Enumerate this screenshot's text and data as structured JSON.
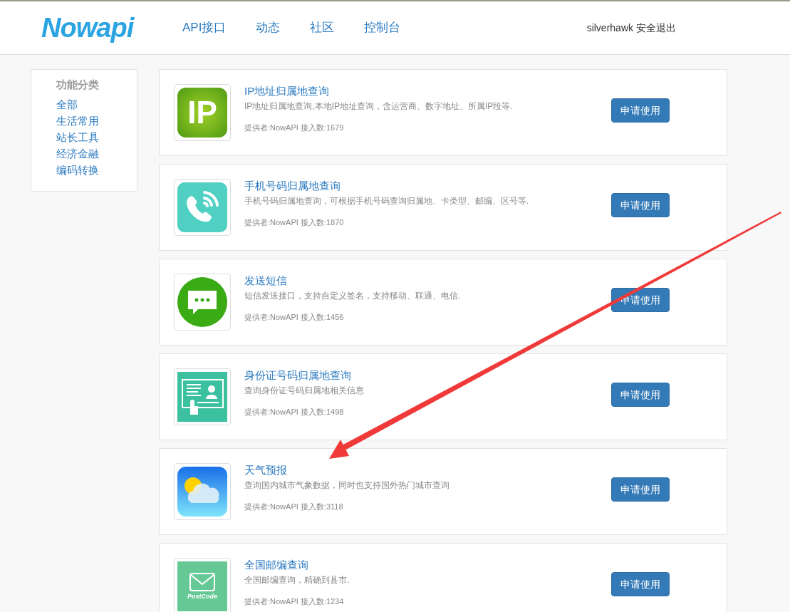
{
  "header": {
    "logo": "Nowapi",
    "nav": [
      {
        "label": "API接口"
      },
      {
        "label": "动态"
      },
      {
        "label": "社区"
      },
      {
        "label": "控制台"
      }
    ],
    "user": "silverhawk",
    "logout": "安全退出"
  },
  "sidebar": {
    "title": "功能分类",
    "items": [
      {
        "label": "全部"
      },
      {
        "label": "生活常用"
      },
      {
        "label": "站长工具"
      },
      {
        "label": "经济金融"
      },
      {
        "label": "编码转换"
      }
    ]
  },
  "apis": [
    {
      "kind": "ip",
      "icon_text": "IP",
      "title": "IP地址归属地查询",
      "description": "IP地址归属地查询,本地IP地址查询，含运营商、数字地址、所属IP段等.",
      "meta": "提供者:NowAPI 接入数:1679",
      "button": "申请使用"
    },
    {
      "kind": "phone",
      "title": "手机号码归属地查询",
      "description": "手机号码归属地查询，可根据手机号码查询归属地、卡类型、邮编、区号等.",
      "meta": "提供者:NowAPI 接入数:1870",
      "button": "申请使用"
    },
    {
      "kind": "sms",
      "title": "发送短信",
      "description": "短信发送接口，支持自定义签名，支持移动、联通、电信.",
      "meta": "提供者:NowAPI 接入数:1456",
      "button": "申请使用"
    },
    {
      "kind": "idcard",
      "title": "身份证号码归属地查询",
      "description": "查询身份证号码归属地相关信息",
      "meta": "提供者:NowAPI 接入数:1498",
      "button": "申请使用"
    },
    {
      "kind": "weather",
      "title": "天气预报",
      "description": "查询国内城市气象数据，同时也支持国外热门城市查询",
      "meta": "提供者:NowAPI 接入数:3118",
      "button": "申请使用"
    },
    {
      "kind": "postcode",
      "icon_text": "PostCode",
      "title": "全国邮编查询",
      "description": "全国邮编查询，精确到县市.",
      "meta": "提供者:NowAPI 接入数:1234",
      "button": "申请使用"
    }
  ]
}
